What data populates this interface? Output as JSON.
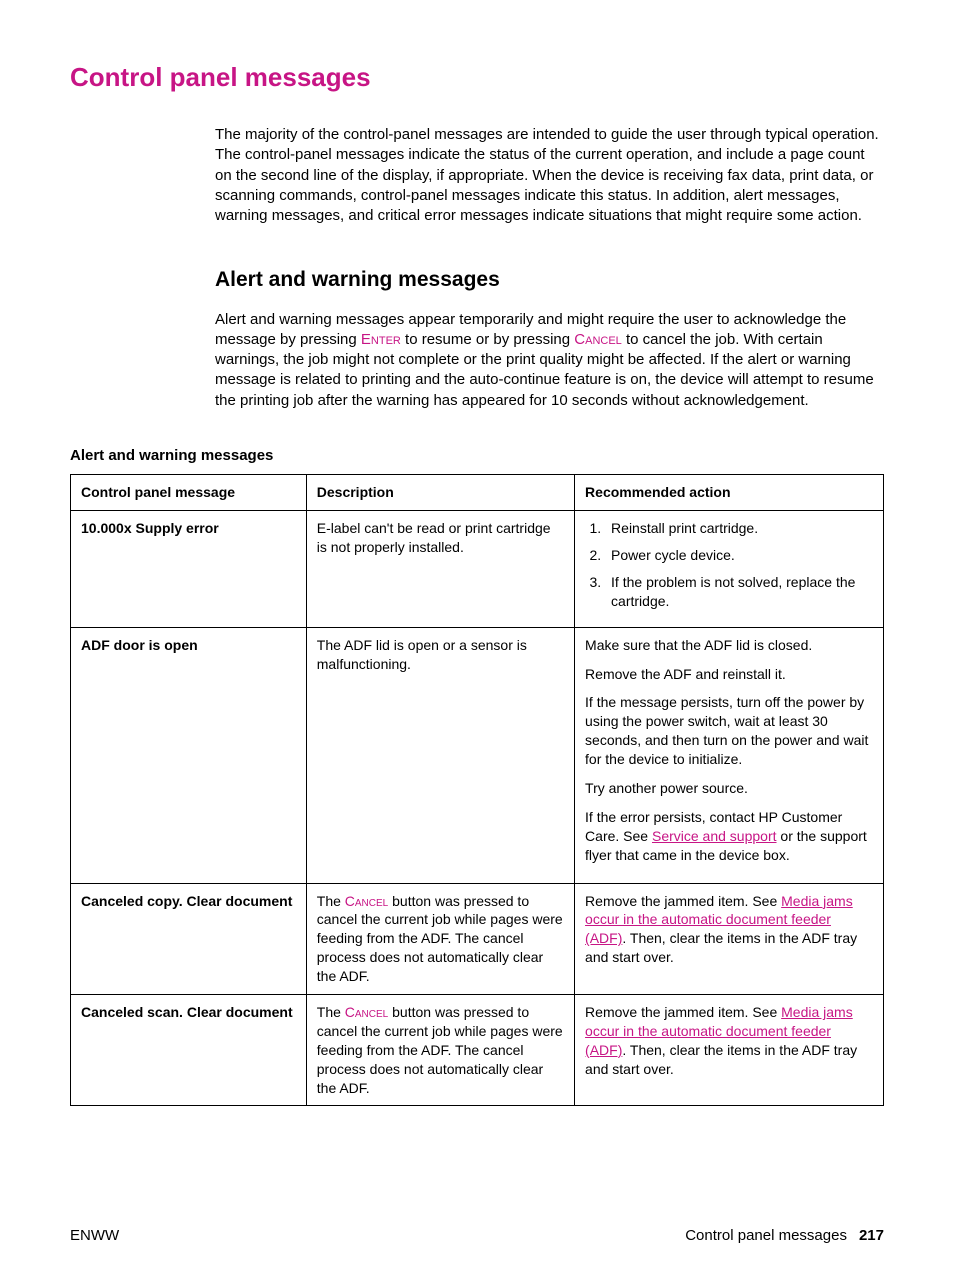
{
  "title": "Control panel messages",
  "intro": "The majority of the control-panel messages are intended to guide the user through typical operation. The control-panel messages indicate the status of the current operation, and include a page count on the second line of the display, if appropriate. When the device is receiving fax data, print data, or scanning commands, control-panel messages indicate this status. In addition, alert messages, warning messages, and critical error messages indicate situations that might require some action.",
  "sub_heading": "Alert and warning messages",
  "sub_text_a": "Alert and warning messages appear temporarily and might require the user to acknowledge the message by pressing ",
  "key_enter": "Enter",
  "sub_text_b": " to resume or by pressing ",
  "key_cancel": "Cancel",
  "sub_text_c": " to cancel the job. With certain warnings, the job might not complete or the print quality might be affected. If the alert or warning message is related to printing and the auto-continue feature is on, the device will attempt to resume the printing job after the warning has appeared for 10 seconds without acknowledgement.",
  "table_caption": "Alert and warning messages",
  "th1": "Control panel message",
  "th2": "Description",
  "th3": "Recommended action",
  "r1_msg": "10.000x Supply error",
  "r1_desc": "E-label can't be read or print cartridge is not properly installed.",
  "r1_act1": "Reinstall print cartridge.",
  "r1_act2": "Power cycle device.",
  "r1_act3": "If the problem is not solved, replace the cartridge.",
  "r2_msg": "ADF door is open",
  "r2_desc": "The ADF lid is open or a sensor is malfunctioning.",
  "r2_p1": "Make sure that the ADF lid is closed.",
  "r2_p2": "Remove the ADF and reinstall it.",
  "r2_p3": "If the message persists, turn off the power by using the power switch, wait at least 30 seconds, and then turn on the power and wait for the device to initialize.",
  "r2_p4": "Try another power source.",
  "r2_p5a": "If the error persists, contact HP Customer Care. See ",
  "r2_link1": "Service and support",
  "r2_p5b": " or the support flyer that came in the device box.",
  "r3_msg": "Canceled copy. Clear document",
  "r3_desc_a": "The ",
  "r3_desc_b": " button was pressed to cancel the current job while pages were feeding from the ADF. The cancel process does not automatically clear the ADF.",
  "r3_act_a": "Remove the jammed item. See ",
  "r3_link": "Media jams occur in the automatic document feeder (ADF)",
  "r3_act_b": ". Then, clear the items in the ADF tray and start over.",
  "r4_msg": "Canceled scan. Clear document",
  "footer_left": "ENWW",
  "footer_right_text": "Control panel messages",
  "footer_page": "217"
}
